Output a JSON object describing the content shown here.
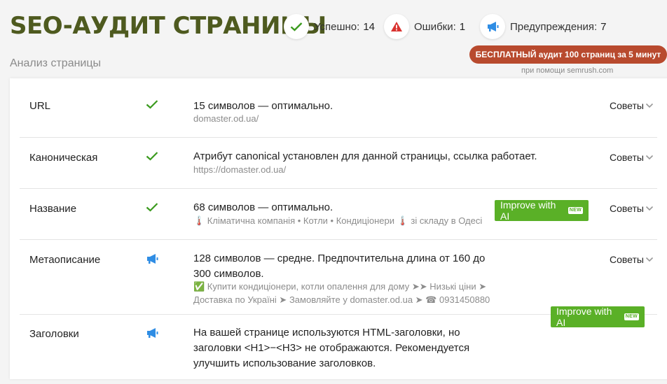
{
  "header": {
    "title": "SEO-АУДИТ СТРАНИЦЫ",
    "subtitle": "Анализ страницы"
  },
  "stats": {
    "success": {
      "label": "Успешно:",
      "count": "14",
      "icon": "check-icon",
      "color": "#3a9a1d"
    },
    "errors": {
      "label": "Ошибки:",
      "count": "1",
      "icon": "warning-icon",
      "color": "#d9322f"
    },
    "warnings": {
      "label": "Предупреждения:",
      "count": "7",
      "icon": "megaphone-icon",
      "color": "#2f8de4"
    }
  },
  "promo": {
    "label": "БЕСПЛАТНЫЙ аудит 100 страниц за 5 минут",
    "powered": "при помощи  semrush.com"
  },
  "ai_button": {
    "label": "Improve with AI",
    "badge": "NEW"
  },
  "rows": [
    {
      "name": "URL",
      "status": "success",
      "text": "15 символов — оптимально.",
      "sub": [
        "domaster.od.ua/"
      ],
      "tips": "Советы"
    },
    {
      "name": "Каноническая",
      "status": "success",
      "text": "Атрибут canonical установлен для данной страницы, ссылка работает.",
      "sub": [
        "https://domaster.od.ua/"
      ],
      "tips": "Советы"
    },
    {
      "name": "Название",
      "status": "success",
      "text": "68 символов — оптимально.",
      "sub": [
        "🌡️ Кліматична компанія • Котли • Кондиціонери 🌡️ зі складу в Одесі"
      ],
      "tips": "Советы"
    },
    {
      "name": "Метаописание",
      "status": "warning",
      "text": "128 символов — средне. Предпочтительна длина от 160 до 300 символов.",
      "sub": [
        "✅ Купити кондиціонери, котли опалення для дому ➤➤ Низькі ціни ➤",
        "Доставка по Україні ➤ Замовляйте у domaster.od.ua ➤ ☎ 0931450880"
      ],
      "tips": "Советы"
    },
    {
      "name": "Заголовки",
      "status": "warning",
      "text": "На вашей странице используются HTML-заголовки, но заголовки <H1>−<H3> не отображаются. Рекомендуется улучшить использование заголовков.",
      "sub": [],
      "tips": ""
    }
  ]
}
